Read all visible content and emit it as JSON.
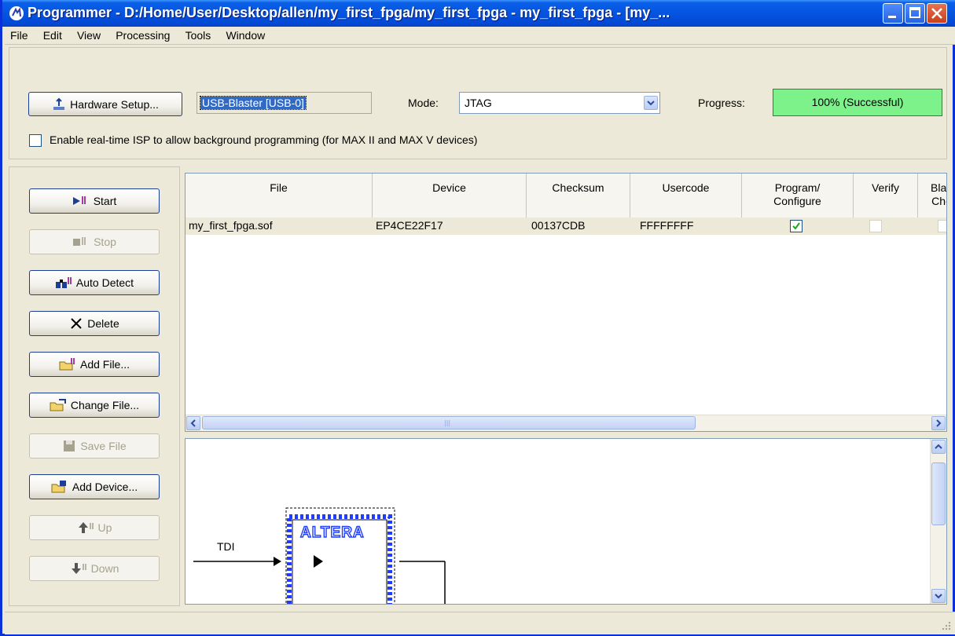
{
  "window": {
    "title": "Programmer - D:/Home/User/Desktop/allen/my_first_fpga/my_first_fpga - my_first_fpga - [my_..."
  },
  "menu": [
    "File",
    "Edit",
    "View",
    "Processing",
    "Tools",
    "Window"
  ],
  "toolbar": {
    "hardware_setup_label": "Hardware Setup...",
    "hardware_value": "USB-Blaster [USB-0]",
    "mode_label": "Mode:",
    "mode_value": "JTAG",
    "progress_label": "Progress:",
    "progress_value": "100% (Successful)",
    "progress_percent": 100,
    "isp_checkbox_label": "Enable real-time ISP to allow background programming (for MAX II and MAX V devices)",
    "isp_checked": false
  },
  "side_buttons": [
    {
      "label": "Start",
      "enabled": true,
      "icon": "start-icon"
    },
    {
      "label": "Stop",
      "enabled": false,
      "icon": "stop-icon"
    },
    {
      "label": "Auto Detect",
      "enabled": true,
      "icon": "auto-detect-icon"
    },
    {
      "label": "Delete",
      "enabled": true,
      "icon": "delete-icon"
    },
    {
      "label": "Add File...",
      "enabled": true,
      "icon": "add-file-icon"
    },
    {
      "label": "Change File...",
      "enabled": true,
      "icon": "change-file-icon"
    },
    {
      "label": "Save File",
      "enabled": false,
      "icon": "save-file-icon"
    },
    {
      "label": "Add Device...",
      "enabled": true,
      "icon": "add-device-icon"
    },
    {
      "label": "Up",
      "enabled": false,
      "icon": "up-icon"
    },
    {
      "label": "Down",
      "enabled": false,
      "icon": "down-icon"
    }
  ],
  "table": {
    "headers": [
      "File",
      "Device",
      "Checksum",
      "Usercode",
      "Program/\nConfigure",
      "Verify",
      "Blan\nChe"
    ],
    "rows": [
      {
        "file": "my_first_fpga.sof",
        "device": "EP4CE22F17",
        "checksum": "00137CDB",
        "usercode": "FFFFFFFF",
        "program": true,
        "verify": false,
        "blank_check": false
      }
    ]
  },
  "diagram": {
    "tdi_label": "TDI",
    "logo_text": "ALTERA"
  },
  "colors": {
    "progress_fill": "#7df28a",
    "title_bar": "#0554e0",
    "chain_blue": "#1f3cff"
  }
}
